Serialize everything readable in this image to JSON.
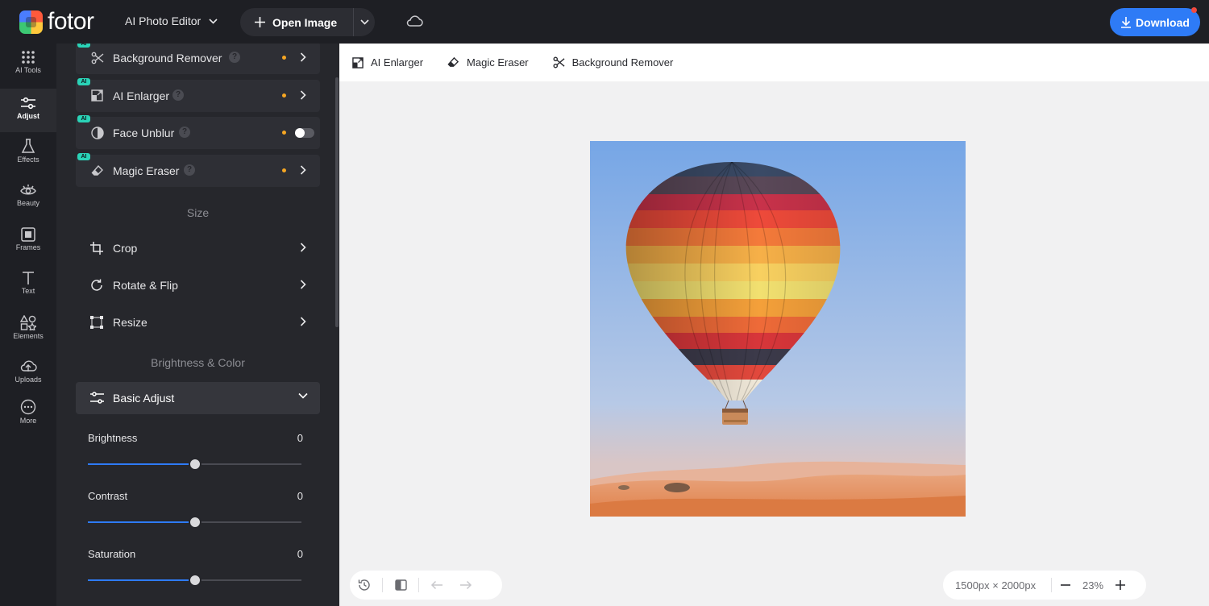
{
  "app": {
    "logo_text": "fotor"
  },
  "header": {
    "editor_mode": "AI Photo Editor",
    "open_image": "Open Image",
    "download": "Download"
  },
  "rail": [
    {
      "label": "AI Tools",
      "icon": "grid-icon"
    },
    {
      "label": "Adjust",
      "icon": "sliders-icon",
      "active": true
    },
    {
      "label": "Effects",
      "icon": "flask-icon"
    },
    {
      "label": "Beauty",
      "icon": "eye-icon"
    },
    {
      "label": "Frames",
      "icon": "frame-icon"
    },
    {
      "label": "Text",
      "icon": "text-icon"
    },
    {
      "label": "Elements",
      "icon": "shapes-icon"
    },
    {
      "label": "Uploads",
      "icon": "upload-cloud-icon"
    },
    {
      "label": "More",
      "icon": "more-icon"
    }
  ],
  "panel": {
    "features": [
      {
        "badge": "AI",
        "label": "Background Remover",
        "control": "chevron"
      },
      {
        "badge": "AI",
        "label": "AI Enlarger",
        "control": "chevron"
      },
      {
        "badge": "AI",
        "label": "Face Unblur",
        "control": "toggle"
      },
      {
        "badge": "AI",
        "label": "Magic Eraser",
        "control": "chevron"
      }
    ],
    "help_glyph": "?",
    "size_title": "Size",
    "size_tools": [
      "Crop",
      "Rotate & Flip",
      "Resize"
    ],
    "color_title": "Brightness & Color",
    "basic_adjust": "Basic Adjust",
    "sliders": [
      {
        "label": "Brightness",
        "value": "0",
        "level": 0.5
      },
      {
        "label": "Contrast",
        "value": "0",
        "level": 0.5
      },
      {
        "label": "Saturation",
        "value": "0",
        "level": 0.5
      }
    ]
  },
  "subtoolbar": [
    "AI Enlarger",
    "Magic Eraser",
    "Background Remover"
  ],
  "canvas": {
    "dimensions": "1500px × 2000px",
    "zoom": "23%"
  },
  "colors": {
    "accent": "#2e7bf6",
    "ai_badge": "#2ad3b7",
    "dot": "#f5a623"
  }
}
